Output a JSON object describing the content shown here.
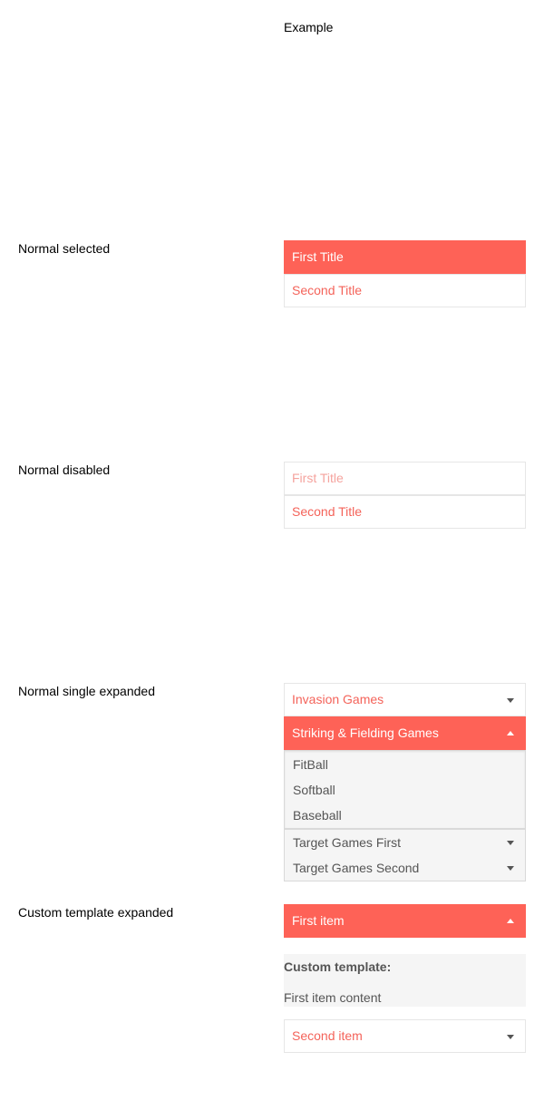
{
  "header": {
    "example": "Example"
  },
  "rows": {
    "normal_selected": {
      "label": "Normal selected",
      "items": [
        "First Title",
        "Second Title"
      ]
    },
    "normal_disabled": {
      "label": "Normal disabled",
      "items": [
        "First Title",
        "Second Title"
      ]
    },
    "single_expanded": {
      "label": "Normal single expanded",
      "items": [
        "Invasion Games",
        "Striking & Fielding Games"
      ],
      "sub_items": [
        "FitBall",
        "Softball",
        "Baseball"
      ],
      "more_items": [
        "Target Games First",
        "Target Games Second"
      ]
    },
    "custom_expanded": {
      "label": "Custom template expanded",
      "first_item": "First item",
      "template_title": "Custom template:",
      "template_content": "First item content",
      "second_item": "Second item"
    }
  },
  "colors": {
    "accent": "#fe6257",
    "accent_text": "#f4635a",
    "disabled_text": "#f5a39e",
    "border": "#e6e6e6",
    "sub_bg": "#f5f5f5"
  },
  "icons": [
    "chevron-down-icon",
    "chevron-up-icon"
  ]
}
